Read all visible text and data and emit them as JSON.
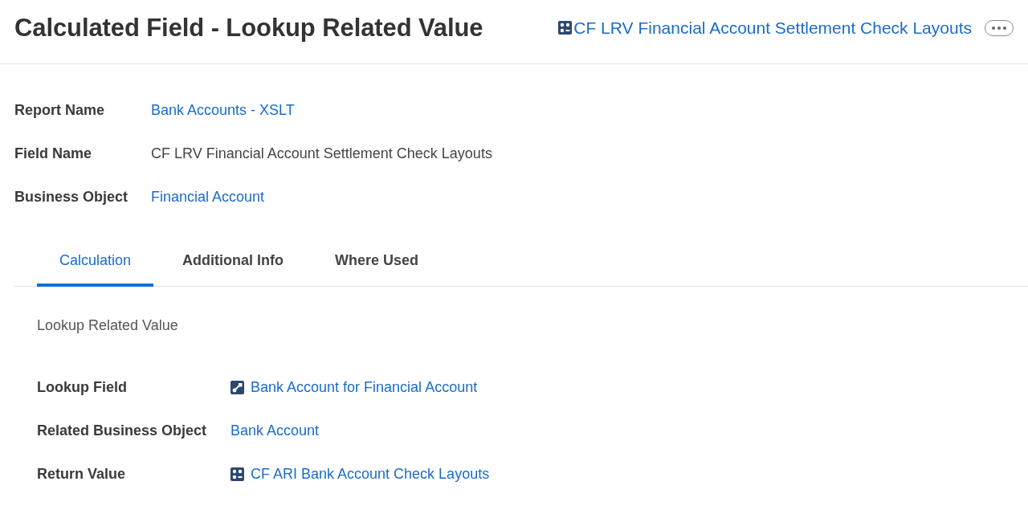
{
  "header": {
    "title": "Calculated Field - Lookup Related Value",
    "link": {
      "kind": "calculated",
      "text": "CF LRV Financial Account Settlement Check Layouts"
    }
  },
  "summary": [
    {
      "label": "Report Name",
      "value": "Bank Accounts - XSLT",
      "kind": "link"
    },
    {
      "label": "Field Name",
      "value": "CF LRV Financial Account Settlement Check Layouts",
      "kind": "text"
    },
    {
      "label": "Business Object",
      "value": "Financial Account",
      "kind": "link"
    }
  ],
  "tabs": [
    {
      "label": "Calculation",
      "selected": true
    },
    {
      "label": "Additional Info",
      "selected": false
    },
    {
      "label": "Where Used",
      "selected": false
    }
  ],
  "calculation": {
    "heading": "Lookup Related Value",
    "fields": [
      {
        "label": "Lookup Field",
        "value": "Bank Account for Financial Account",
        "kind": "lookup"
      },
      {
        "label": "Related Business Object",
        "value": "Bank Account",
        "kind": "link"
      },
      {
        "label": "Return Value",
        "value": "CF ARI Bank Account Check Layouts",
        "kind": "calculated"
      }
    ]
  }
}
